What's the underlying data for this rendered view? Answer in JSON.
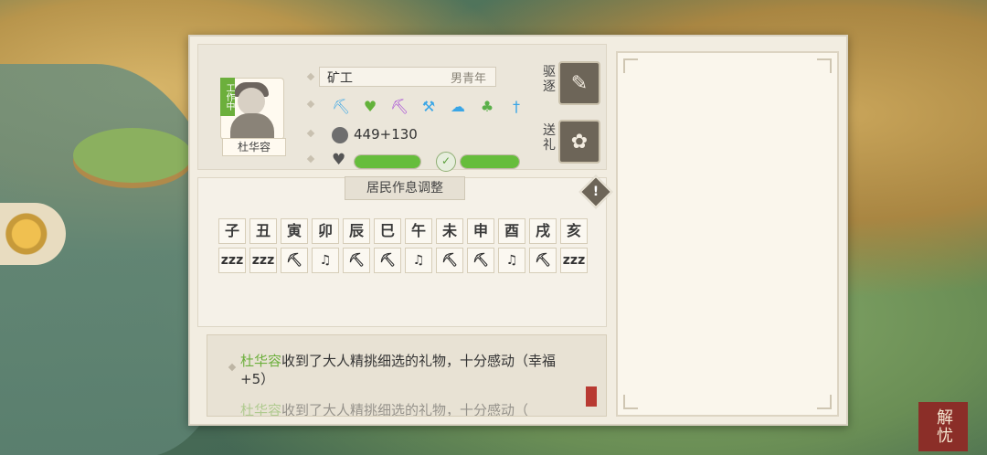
{
  "background": {
    "seal_text": "解忧"
  },
  "resident": {
    "name": "杜华容",
    "status_tag": "工作中",
    "role": "矿工",
    "role_detail": "男青年",
    "skill_icons": [
      "pickaxe-icon",
      "heart-leaf-icon",
      "pickaxe-icon",
      "crossed-pickaxes-icon",
      "cloud-icon",
      "sprout-icon",
      "sword-icon"
    ],
    "money": "449+130",
    "health_progress": 1.0,
    "happiness_progress": 1.0
  },
  "actions": {
    "expel_label": "驱逐",
    "gift_label": "送礼"
  },
  "schedule": {
    "title": "居民作息调整",
    "hours": [
      "子",
      "丑",
      "寅",
      "卯",
      "辰",
      "巳",
      "午",
      "未",
      "申",
      "酉",
      "戌",
      "亥"
    ],
    "activities": [
      "zzz",
      "zzz",
      "⛏",
      "♫",
      "⛏",
      "⛏",
      "♫",
      "⛏",
      "⛏",
      "♫",
      "⛏",
      "zzz"
    ]
  },
  "log": {
    "entries": [
      {
        "name": "杜华容",
        "text": "收到了大人精挑细选的礼物，十分感动（幸福+5）"
      },
      {
        "name": "杜华容",
        "text": "收到了大人精挑细选的礼物，十分感动（"
      }
    ]
  },
  "colors": {
    "accent_green": "#6caf3c",
    "panel_bg": "#f2ede1",
    "skill_blue": "#3aa6e6"
  }
}
